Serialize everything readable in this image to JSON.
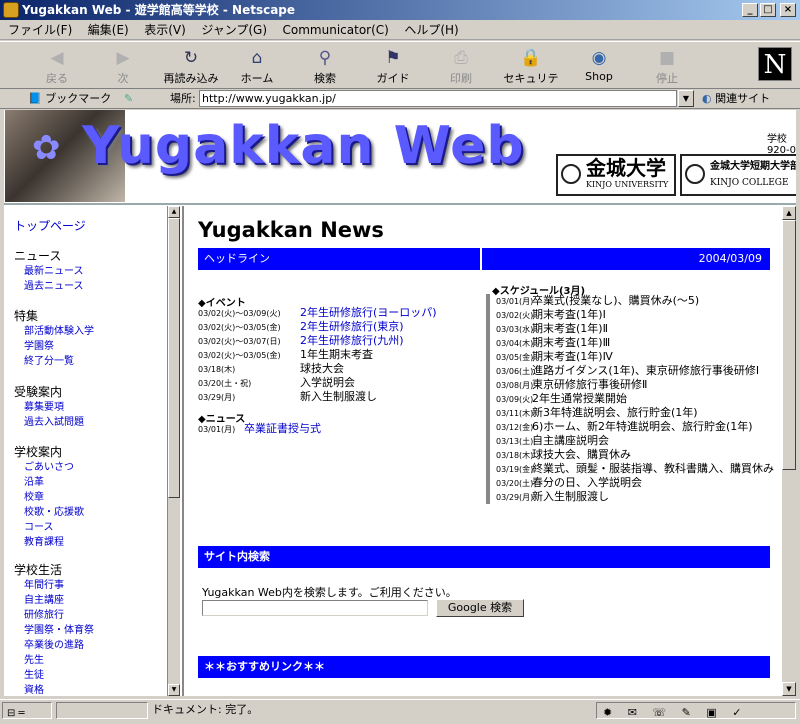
{
  "window": {
    "title": "Yugakkan Web - 遊学館高等学校 - Netscape",
    "min": "_",
    "max": "□",
    "close": "×"
  },
  "menu": [
    "ファイル(F)",
    "編集(E)",
    "表示(V)",
    "ジャンプ(G)",
    "Communicator(C)",
    "ヘルプ(H)"
  ],
  "toolbar": [
    {
      "label": "戻る",
      "icon": "back-arrow",
      "enabled": false
    },
    {
      "label": "次",
      "icon": "forward-arrow",
      "enabled": false
    },
    {
      "label": "再読み込み",
      "icon": "reload",
      "enabled": true
    },
    {
      "label": "ホーム",
      "icon": "home",
      "enabled": true
    },
    {
      "label": "検索",
      "icon": "search",
      "enabled": true
    },
    {
      "label": "ガイド",
      "icon": "guide",
      "enabled": true
    },
    {
      "label": "印刷",
      "icon": "print",
      "enabled": false
    },
    {
      "label": "セキュリティ",
      "icon": "security-lock",
      "enabled": true
    },
    {
      "label": "Shop",
      "icon": "shop",
      "enabled": true
    },
    {
      "label": "停止",
      "icon": "stop",
      "enabled": false
    }
  ],
  "location": {
    "bookmarks": "ブックマーク",
    "label": "場所:",
    "url": "http://www.yugakkan.jp/",
    "related": "関連サイト"
  },
  "banner": {
    "logo": "Yugakkan Web",
    "univ1_big": "金城大学",
    "univ1_small": "KINJO UNIVERSITY",
    "univ2_big": "金城大学短期大学部",
    "univ2_small": "KINJO COLLEGE",
    "corner1": "学校",
    "corner2": "920-0"
  },
  "sidebar": {
    "top": "トップページ",
    "groups": [
      {
        "head": "ニュース",
        "items": [
          "最新ニュース",
          "過去ニュース"
        ]
      },
      {
        "head": "特集",
        "items": [
          "部活動体験入学",
          "学園祭",
          "終了分一覧"
        ]
      },
      {
        "head": "受験案内",
        "items": [
          "募集要項",
          "過去入試問題"
        ]
      },
      {
        "head": "学校案内",
        "items": [
          "ごあいさつ",
          "沿革",
          "校章",
          "校歌・応援歌",
          "コース",
          "教育課程"
        ]
      },
      {
        "head": "学校生活",
        "items": [
          "年間行事",
          "自主講座",
          "研修旅行",
          "学園祭・体育祭",
          "卒業後の進路",
          "先生",
          "生徒",
          "資格"
        ]
      }
    ]
  },
  "news": {
    "title": "Yugakkan News",
    "headline_label": "ヘッドライン",
    "date": "2004/03/09",
    "events_head": "◆イベント",
    "events": [
      {
        "date": "03/02(火)～03/09(火)",
        "text": "2年生研修旅行(ヨーロッパ)",
        "link": true
      },
      {
        "date": "03/02(火)～03/05(金)",
        "text": "2年生研修旅行(東京)",
        "link": true
      },
      {
        "date": "03/02(火)～03/07(日)",
        "text": "2年生研修旅行(九州)",
        "link": true
      },
      {
        "date": "03/02(火)～03/05(金)",
        "text": "1年生期末考査",
        "link": false
      },
      {
        "date": "03/18(木)",
        "text": "球技大会",
        "link": false
      },
      {
        "date": "03/20(土・祝)",
        "text": "入学説明会",
        "link": false
      },
      {
        "date": "03/29(月)",
        "text": "新入生制服渡し",
        "link": false
      }
    ],
    "news_head": "◆ニュース",
    "news_items": [
      {
        "date": "03/01(月)",
        "text": "卒業証書授与式",
        "link": true
      }
    ],
    "schedule_head": "◆スケジュール(3月)",
    "schedule": [
      {
        "date": "03/01(月)",
        "text": "卒業式(授業なし)、購買休み(～5)"
      },
      {
        "date": "03/02(火)",
        "text": "期末考査(1年)Ⅰ"
      },
      {
        "date": "03/03(水)",
        "text": "期末考査(1年)Ⅱ"
      },
      {
        "date": "03/04(木)",
        "text": "期末考査(1年)Ⅲ"
      },
      {
        "date": "03/05(金)",
        "text": "期末考査(1年)Ⅳ"
      },
      {
        "date": "03/06(土)",
        "text": "進路ガイダンス(1年)、東京研修旅行事後研修Ⅰ"
      },
      {
        "date": "03/08(月)",
        "text": "東京研修旅行事後研修Ⅱ"
      },
      {
        "date": "03/09(火)",
        "text": "2年生通常授業開始"
      },
      {
        "date": "03/11(木)",
        "text": "新3年特進説明会、旅行貯金(1年)"
      },
      {
        "date": "03/12(金)",
        "text": "6)ホーム、新2年特進説明会、旅行貯金(1年)"
      },
      {
        "date": "03/13(土)",
        "text": "自主講座説明会"
      },
      {
        "date": "03/18(木)",
        "text": "球技大会、購買休み"
      },
      {
        "date": "03/19(金)",
        "text": "終業式、頭髪・服装指導、教科書購入、購買休み"
      },
      {
        "date": "03/20(土)",
        "text": "春分の日、入学説明会"
      },
      {
        "date": "03/29(月)",
        "text": "新入生制服渡し"
      }
    ],
    "search_head": "サイト内検索",
    "search_desc": "Yugakkan Web内を検索します。ご利用ください。",
    "search_value": "",
    "search_button": "Google 検索",
    "recommend_head": "＊＊おすすめリンク＊＊"
  },
  "status": {
    "text": "ドキュメント: 完了。"
  },
  "colors": {
    "link": "#0000cc",
    "bar": "#0000ff",
    "titlebar": "#0a246a"
  }
}
